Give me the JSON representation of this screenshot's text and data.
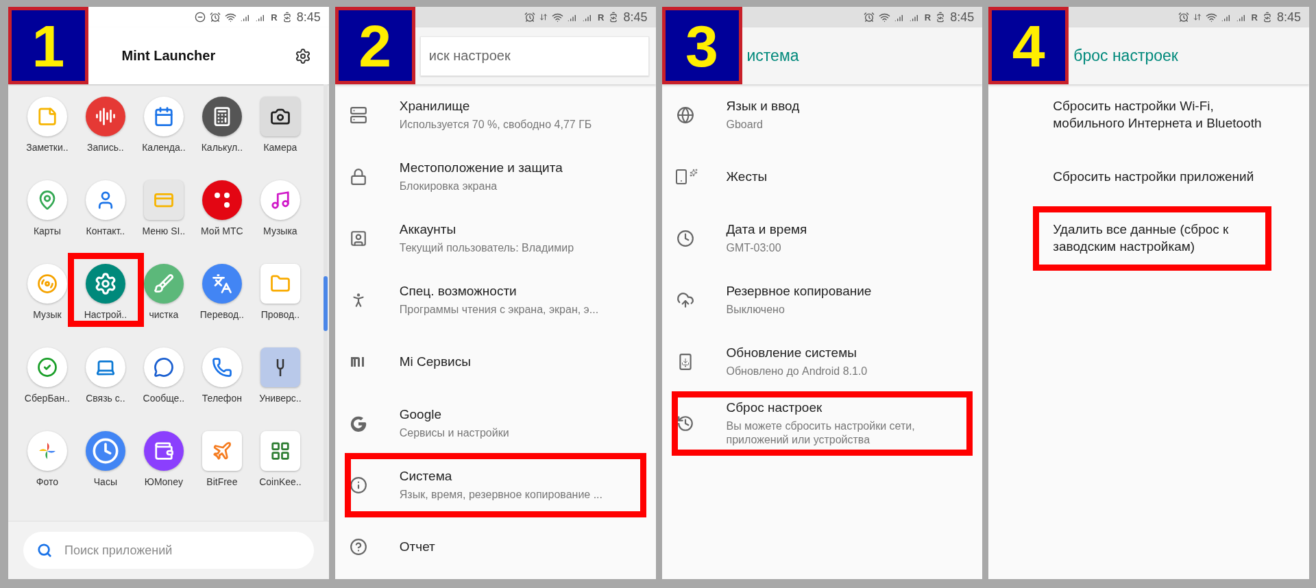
{
  "panels": [
    {
      "kind": "launcher",
      "badge": "1",
      "status": {
        "roaming": "R",
        "time": "8:45"
      },
      "title": "Mint Launcher",
      "apps": [
        {
          "label": "Заметки..",
          "highlighted": false
        },
        {
          "label": "Запись..",
          "highlighted": false
        },
        {
          "label": "Календа..",
          "highlighted": false
        },
        {
          "label": "Калькул..",
          "highlighted": false
        },
        {
          "label": "Камера",
          "highlighted": false
        },
        {
          "label": "Карты",
          "highlighted": false
        },
        {
          "label": "Контакт..",
          "highlighted": false
        },
        {
          "label": "Меню SI..",
          "highlighted": false
        },
        {
          "label": "Мой МТС",
          "highlighted": false
        },
        {
          "label": "Музыка",
          "highlighted": false
        },
        {
          "label": "Музык",
          "highlighted": false
        },
        {
          "label": "Настрой..",
          "highlighted": true
        },
        {
          "label": "чистка",
          "highlighted": false
        },
        {
          "label": "Перевод..",
          "highlighted": false
        },
        {
          "label": "Провод..",
          "highlighted": false
        },
        {
          "label": "СберБан..",
          "highlighted": false
        },
        {
          "label": "Связь с..",
          "highlighted": false
        },
        {
          "label": "Сообще..",
          "highlighted": false
        },
        {
          "label": "Телефон",
          "highlighted": false
        },
        {
          "label": "Универс..",
          "highlighted": false
        },
        {
          "label": "Фото",
          "highlighted": false
        },
        {
          "label": "Часы",
          "highlighted": false
        },
        {
          "label": "ЮMoney",
          "highlighted": false
        },
        {
          "label": "BitFree",
          "highlighted": false
        },
        {
          "label": "CoinKee..",
          "highlighted": false
        }
      ],
      "search": {
        "placeholder": "Поиск приложений"
      }
    },
    {
      "kind": "settings",
      "badge": "2",
      "status": {
        "roaming": "R",
        "time": "8:45"
      },
      "search": {
        "placeholder": "иск настроек"
      },
      "items": [
        {
          "title": "Хранилище",
          "subtitle": "Используется 70 %, свободно 4,77 ГБ",
          "highlighted": false
        },
        {
          "title": "Местоположение и защита",
          "subtitle": "Блокировка экрана",
          "highlighted": false
        },
        {
          "title": "Аккаунты",
          "subtitle": "Текущий пользователь: Владимир",
          "highlighted": false
        },
        {
          "title": "Спец. возможности",
          "subtitle": "Программы чтения с экрана, экран, э...",
          "highlighted": false
        },
        {
          "title": "Mi Сервисы",
          "highlighted": false
        },
        {
          "title": "Google",
          "subtitle": "Сервисы и настройки",
          "highlighted": false
        },
        {
          "title": "Система",
          "subtitle": "Язык, время, резервное копирование ...",
          "highlighted": true
        },
        {
          "title": "Отчет",
          "highlighted": false
        }
      ]
    },
    {
      "kind": "settings",
      "badge": "3",
      "status": {
        "roaming": "R",
        "time": "8:45"
      },
      "title": "истема",
      "items": [
        {
          "title": "Язык и ввод",
          "subtitle": "Gboard",
          "highlighted": false
        },
        {
          "title": "Жесты",
          "highlighted": false
        },
        {
          "title": "Дата и время",
          "subtitle": "GMT-03:00",
          "highlighted": false
        },
        {
          "title": "Резервное копирование",
          "subtitle": "Выключено",
          "highlighted": false
        },
        {
          "title": "Обновление системы",
          "subtitle": "Обновлено до Android 8.1.0",
          "highlighted": false
        },
        {
          "title": "Сброс настроек",
          "subtitle": "Вы можете сбросить настройки сети, приложений или устройства",
          "highlighted": true
        }
      ]
    },
    {
      "kind": "settings",
      "badge": "4",
      "status": {
        "roaming": "R",
        "time": "8:45"
      },
      "title": "брос настроек",
      "items": [
        {
          "title": "Сбросить настройки Wi-Fi, мобильного Интернета и Bluetooth",
          "highlighted": false
        },
        {
          "title": "Сбросить настройки приложений",
          "highlighted": false
        },
        {
          "title": "Удалить все данные (сброс к заводским настройкам)",
          "highlighted": true
        }
      ]
    }
  ]
}
